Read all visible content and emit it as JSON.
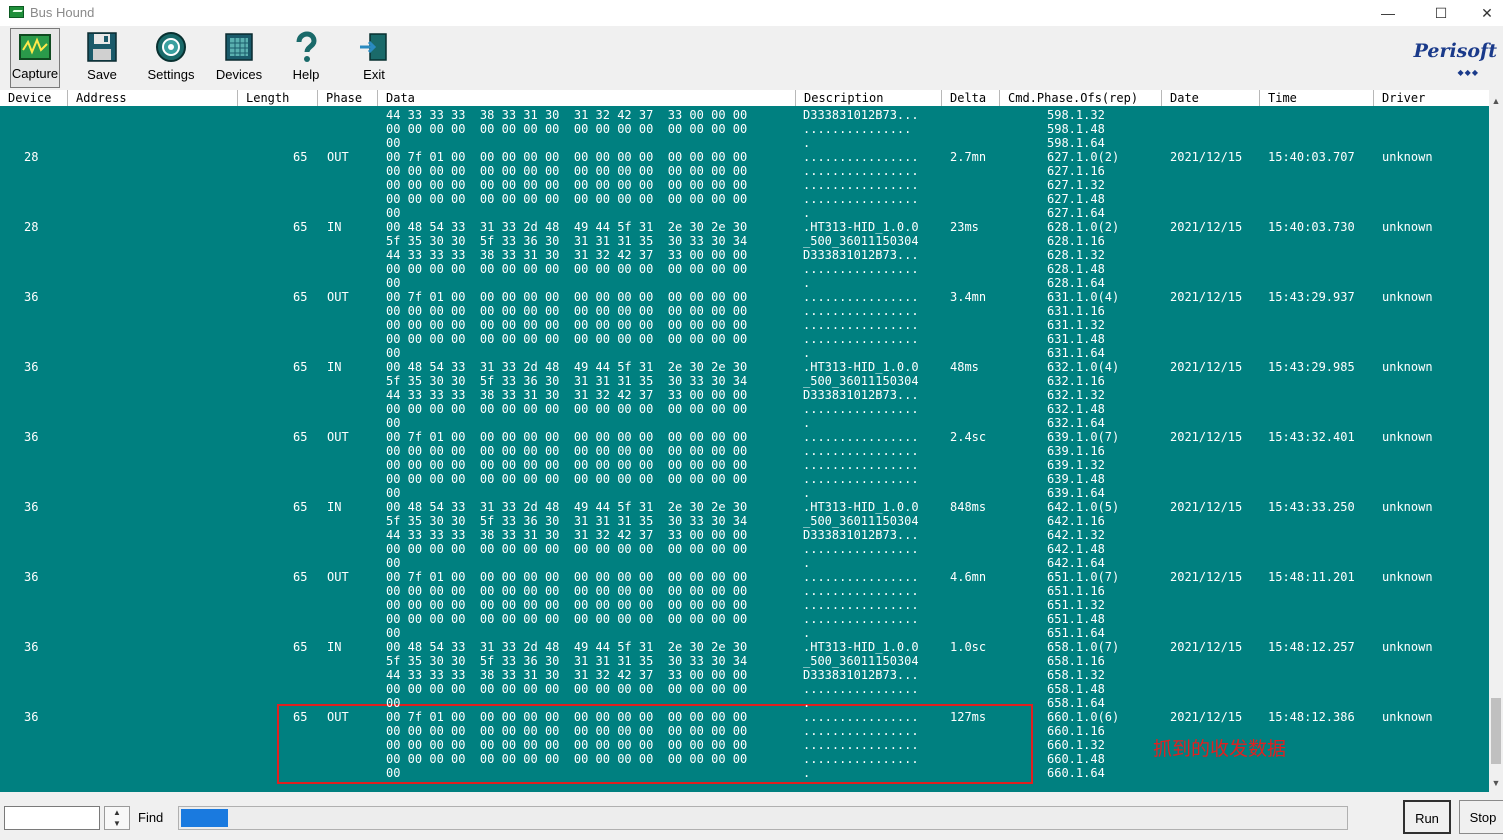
{
  "window": {
    "title": "Bus Hound",
    "minimize": "—",
    "maximize": "☐",
    "close": "✕"
  },
  "toolbar": {
    "buttons": [
      {
        "label": "Capture",
        "icon": "capture-icon"
      },
      {
        "label": "Save",
        "icon": "floppy-disk-icon"
      },
      {
        "label": "Settings",
        "icon": "gear-icon"
      },
      {
        "label": "Devices",
        "icon": "chip-icon"
      },
      {
        "label": "Help",
        "icon": "question-mark-icon"
      },
      {
        "label": "Exit",
        "icon": "exit-door-icon"
      }
    ],
    "logo": "Perisoft",
    "logo_dots": "◆◆◆"
  },
  "columns": [
    "Device",
    "Address",
    "Length",
    "Phase",
    "Data",
    "Description",
    "Delta",
    "Cmd.Phase.Ofs(rep)",
    "Date",
    "Time",
    "Driver"
  ],
  "rows": [
    {
      "device": "",
      "length": "",
      "phase": "",
      "data": [
        "44 33 33 33  38 33 31 30  31 32 42 37  33 00 00 00",
        "00 00 00 00  00 00 00 00  00 00 00 00  00 00 00 00",
        "00"
      ],
      "desc": [
        "D333831012B73...",
        "...............",
        "."
      ],
      "delta": "",
      "cmd": [
        "598.1.32",
        "598.1.48",
        "598.1.64"
      ],
      "date": "",
      "time": "",
      "driver": ""
    },
    {
      "device": "28",
      "length": "65",
      "phase": "OUT",
      "data": [
        "00 7f 01 00  00 00 00 00  00 00 00 00  00 00 00 00",
        "00 00 00 00  00 00 00 00  00 00 00 00  00 00 00 00",
        "00 00 00 00  00 00 00 00  00 00 00 00  00 00 00 00",
        "00 00 00 00  00 00 00 00  00 00 00 00  00 00 00 00",
        "00"
      ],
      "desc": [
        "................",
        "................",
        "................",
        "................",
        "."
      ],
      "delta": "2.7mn",
      "cmd": [
        "627.1.0(2)",
        "627.1.16",
        "627.1.32",
        "627.1.48",
        "627.1.64"
      ],
      "date": "2021/12/15",
      "time": "15:40:03.707",
      "driver": "unknown"
    },
    {
      "device": "28",
      "length": "65",
      "phase": "IN",
      "data": [
        "00 48 54 33  31 33 2d 48  49 44 5f 31  2e 30 2e 30",
        "5f 35 30 30  5f 33 36 30  31 31 31 35  30 33 30 34",
        "44 33 33 33  38 33 31 30  31 32 42 37  33 00 00 00",
        "00 00 00 00  00 00 00 00  00 00 00 00  00 00 00 00",
        "00"
      ],
      "desc": [
        ".HT313-HID_1.0.0",
        "_500_36011150304",
        "D333831012B73...",
        "................",
        "."
      ],
      "delta": "23ms",
      "cmd": [
        "628.1.0(2)",
        "628.1.16",
        "628.1.32",
        "628.1.48",
        "628.1.64"
      ],
      "date": "2021/12/15",
      "time": "15:40:03.730",
      "driver": "unknown"
    },
    {
      "device": "36",
      "length": "65",
      "phase": "OUT",
      "data": [
        "00 7f 01 00  00 00 00 00  00 00 00 00  00 00 00 00",
        "00 00 00 00  00 00 00 00  00 00 00 00  00 00 00 00",
        "00 00 00 00  00 00 00 00  00 00 00 00  00 00 00 00",
        "00 00 00 00  00 00 00 00  00 00 00 00  00 00 00 00",
        "00"
      ],
      "desc": [
        "................",
        "................",
        "................",
        "................",
        "."
      ],
      "delta": "3.4mn",
      "cmd": [
        "631.1.0(4)",
        "631.1.16",
        "631.1.32",
        "631.1.48",
        "631.1.64"
      ],
      "date": "2021/12/15",
      "time": "15:43:29.937",
      "driver": "unknown"
    },
    {
      "device": "36",
      "length": "65",
      "phase": "IN",
      "data": [
        "00 48 54 33  31 33 2d 48  49 44 5f 31  2e 30 2e 30",
        "5f 35 30 30  5f 33 36 30  31 31 31 35  30 33 30 34",
        "44 33 33 33  38 33 31 30  31 32 42 37  33 00 00 00",
        "00 00 00 00  00 00 00 00  00 00 00 00  00 00 00 00",
        "00"
      ],
      "desc": [
        ".HT313-HID_1.0.0",
        "_500_36011150304",
        "D333831012B73...",
        "................",
        "."
      ],
      "delta": "48ms",
      "cmd": [
        "632.1.0(4)",
        "632.1.16",
        "632.1.32",
        "632.1.48",
        "632.1.64"
      ],
      "date": "2021/12/15",
      "time": "15:43:29.985",
      "driver": "unknown"
    },
    {
      "device": "36",
      "length": "65",
      "phase": "OUT",
      "data": [
        "00 7f 01 00  00 00 00 00  00 00 00 00  00 00 00 00",
        "00 00 00 00  00 00 00 00  00 00 00 00  00 00 00 00",
        "00 00 00 00  00 00 00 00  00 00 00 00  00 00 00 00",
        "00 00 00 00  00 00 00 00  00 00 00 00  00 00 00 00",
        "00"
      ],
      "desc": [
        "................",
        "................",
        "................",
        "................",
        "."
      ],
      "delta": "2.4sc",
      "cmd": [
        "639.1.0(7)",
        "639.1.16",
        "639.1.32",
        "639.1.48",
        "639.1.64"
      ],
      "date": "2021/12/15",
      "time": "15:43:32.401",
      "driver": "unknown"
    },
    {
      "device": "36",
      "length": "65",
      "phase": "IN",
      "data": [
        "00 48 54 33  31 33 2d 48  49 44 5f 31  2e 30 2e 30",
        "5f 35 30 30  5f 33 36 30  31 31 31 35  30 33 30 34",
        "44 33 33 33  38 33 31 30  31 32 42 37  33 00 00 00",
        "00 00 00 00  00 00 00 00  00 00 00 00  00 00 00 00",
        "00"
      ],
      "desc": [
        ".HT313-HID_1.0.0",
        "_500_36011150304",
        "D333831012B73...",
        "................",
        "."
      ],
      "delta": "848ms",
      "cmd": [
        "642.1.0(5)",
        "642.1.16",
        "642.1.32",
        "642.1.48",
        "642.1.64"
      ],
      "date": "2021/12/15",
      "time": "15:43:33.250",
      "driver": "unknown"
    },
    {
      "device": "36",
      "length": "65",
      "phase": "OUT",
      "data": [
        "00 7f 01 00  00 00 00 00  00 00 00 00  00 00 00 00",
        "00 00 00 00  00 00 00 00  00 00 00 00  00 00 00 00",
        "00 00 00 00  00 00 00 00  00 00 00 00  00 00 00 00",
        "00 00 00 00  00 00 00 00  00 00 00 00  00 00 00 00",
        "00"
      ],
      "desc": [
        "................",
        "................",
        "................",
        "................",
        "."
      ],
      "delta": "4.6mn",
      "cmd": [
        "651.1.0(7)",
        "651.1.16",
        "651.1.32",
        "651.1.48",
        "651.1.64"
      ],
      "date": "2021/12/15",
      "time": "15:48:11.201",
      "driver": "unknown"
    },
    {
      "device": "36",
      "length": "65",
      "phase": "IN",
      "data": [
        "00 48 54 33  31 33 2d 48  49 44 5f 31  2e 30 2e 30",
        "5f 35 30 30  5f 33 36 30  31 31 31 35  30 33 30 34",
        "44 33 33 33  38 33 31 30  31 32 42 37  33 00 00 00",
        "00 00 00 00  00 00 00 00  00 00 00 00  00 00 00 00",
        "00"
      ],
      "desc": [
        ".HT313-HID_1.0.0",
        "_500_36011150304",
        "D333831012B73...",
        "................",
        "."
      ],
      "delta": "1.0sc",
      "cmd": [
        "658.1.0(7)",
        "658.1.16",
        "658.1.32",
        "658.1.48",
        "658.1.64"
      ],
      "date": "2021/12/15",
      "time": "15:48:12.257",
      "driver": "unknown"
    },
    {
      "device": "36",
      "length": "65",
      "phase": "OUT",
      "data": [
        "00 7f 01 00  00 00 00 00  00 00 00 00  00 00 00 00",
        "00 00 00 00  00 00 00 00  00 00 00 00  00 00 00 00",
        "00 00 00 00  00 00 00 00  00 00 00 00  00 00 00 00",
        "00 00 00 00  00 00 00 00  00 00 00 00  00 00 00 00",
        "00"
      ],
      "desc": [
        "................",
        "................",
        "................",
        "................",
        "."
      ],
      "delta": "127ms",
      "cmd": [
        "660.1.0(6)",
        "660.1.16",
        "660.1.32",
        "660.1.48",
        "660.1.64"
      ],
      "date": "2021/12/15",
      "time": "15:48:12.386",
      "driver": "unknown"
    }
  ],
  "annotation": "抓到的收发数据",
  "bottom": {
    "find_value": "",
    "find_label": "Find",
    "progress": 0.04,
    "run_label": "Run",
    "stop_label": "Stop"
  },
  "colors": {
    "background": "#008080",
    "text": "#ffffff",
    "highlight": "#e02020",
    "progress": "#1a7adf"
  }
}
